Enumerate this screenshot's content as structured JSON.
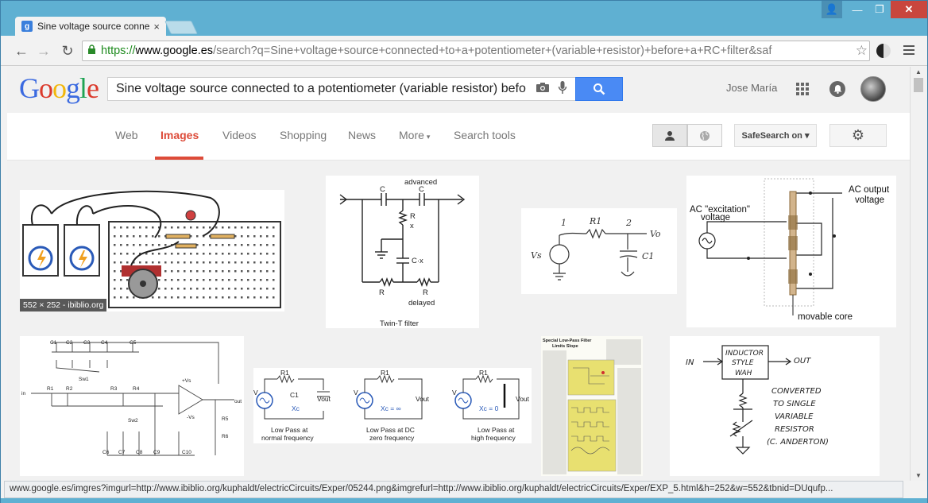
{
  "browser": {
    "tab_title": "Sine voltage source conne",
    "tab_close": "×",
    "favicon": "g",
    "url_scheme": "https://",
    "url_host": "www.google.es",
    "url_path": "/search?q=Sine+voltage+source+connected+to+a+potentiometer+(variable+resistor)+before+a+RC+filter&saf",
    "back_icon": "←",
    "forward_icon": "→",
    "reload_icon": "↻",
    "star_icon": "☆",
    "lock_icon": "🔒",
    "user_icon": "👤",
    "minimize": "—",
    "maximize": "❐",
    "close": "✕"
  },
  "google": {
    "logo_letters": [
      "G",
      "o",
      "o",
      "g",
      "l",
      "e"
    ],
    "logo_colors": [
      "#3b6ae0",
      "#db3a2c",
      "#f2b70b",
      "#3b6ae0",
      "#1ea353",
      "#db3a2c"
    ],
    "query": "Sine voltage source connected to a potentiometer (variable resistor) befo",
    "camera_icon": "📷",
    "mic_icon": "🎤",
    "search_icon": "🔍",
    "user_name": "Jose María",
    "bell_icon": "🔔"
  },
  "tabs": {
    "web": "Web",
    "images": "Images",
    "videos": "Videos",
    "shopping": "Shopping",
    "news": "News",
    "more": "More",
    "more_caret": "▾",
    "search_tools": "Search tools",
    "person_icon": "👤",
    "globe_icon": "🌐",
    "safesearch": "SafeSearch on",
    "safesearch_caret": "▾",
    "gear_icon": "⚙"
  },
  "results": {
    "thumb1_overlay": "552 × 252 - ibiblio.org",
    "twin_t": {
      "top_label": "advanced",
      "c1": "C",
      "c2": "C",
      "r_top": "R",
      "x_label": "x",
      "cx_label": "C·x",
      "r_left": "R",
      "r_right": "R",
      "delayed": "delayed",
      "caption": "Twin-T filter"
    },
    "hand_rc": {
      "n1": "1",
      "n2": "2",
      "r1": "R1",
      "vs": "Vs",
      "vo": "Vo",
      "c1": "C1"
    },
    "lvdt": {
      "ac_out": "AC output",
      "voltage_out": "voltage",
      "ac_exc": "AC \"excitation\"",
      "voltage_in": "voltage",
      "movable": "movable core"
    },
    "filter_sw": {
      "c1": "C1",
      "c2": "C2",
      "c3": "C3",
      "c4": "C4",
      "c5": "C5",
      "sw1": "Sw1",
      "sw2": "Sw2",
      "r1": "R1",
      "r2": "R2",
      "r3": "R3",
      "r4": "R4",
      "r5": "R5",
      "r6": "R6",
      "vs_plus": "+Vs",
      "vs_minus": "-Vs",
      "in_label": "in",
      "out_label": "out",
      "c6": "C6",
      "c7": "C7",
      "c8": "C8",
      "c9": "C9",
      "c10": "C10"
    },
    "lowpass": {
      "r1": "R1",
      "c1": "C1",
      "v": "V",
      "vout": "Vout",
      "xc": "Xc",
      "xc_inf": "Xc = ∞",
      "xc_zero": "Xc = 0",
      "cap_a1": "Low Pass at",
      "cap_a2": "normal frequency",
      "cap_b1": "Low Pass at DC",
      "cap_b2": "zero frequency",
      "cap_c1": "Low Pass at",
      "cap_c2": "high frequency"
    },
    "article": {
      "title1": "Special Low-Pass Filter",
      "title2": "Limits Slope"
    },
    "wah": {
      "in": "IN",
      "out": "OUT",
      "box1": "INDUCTOR",
      "box2": "STYLE",
      "box3": "WAH",
      "n1": "CONVERTED",
      "n2": "TO SINGLE",
      "n3": "VARIABLE",
      "n4": "RESISTOR",
      "n5": "(C. ANDERTON)"
    }
  },
  "status_url": "www.google.es/imgres?imgurl=http://www.ibiblio.org/kuphaldt/electricCircuits/Exper/05244.png&imgrefurl=http://www.ibiblio.org/kuphaldt/electricCircuits/Exper/EXP_5.html&h=252&w=552&tbnid=DUqufp..."
}
